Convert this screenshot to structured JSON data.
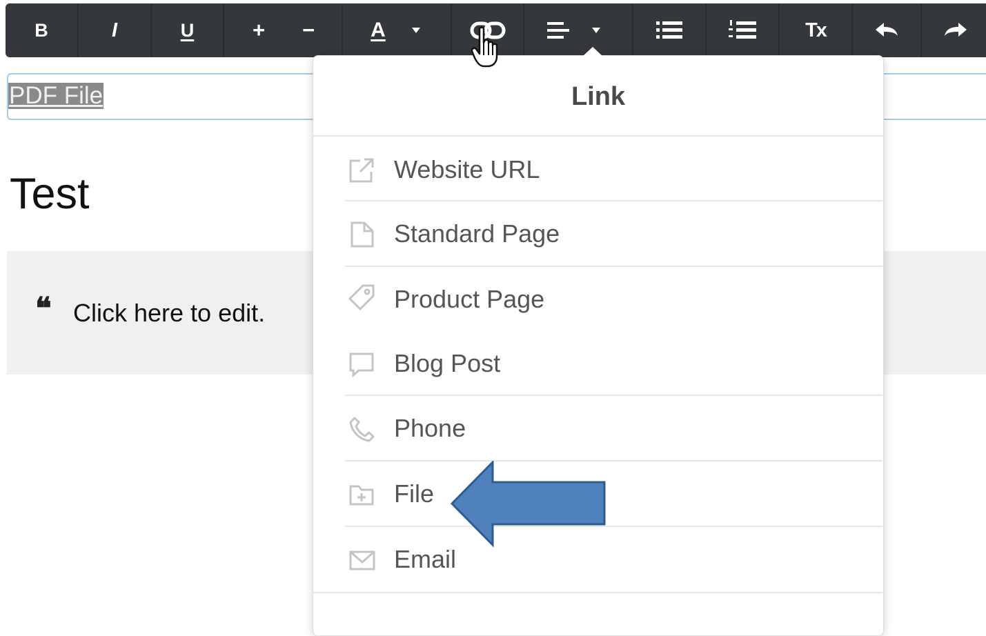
{
  "toolbar": {
    "bold": "B",
    "italic": "I",
    "underline": "U",
    "increase_size": "+",
    "decrease_size": "−",
    "text_color": "A",
    "clear_format": "Tx"
  },
  "field": {
    "value": "PDF File"
  },
  "content": {
    "heading": "Test",
    "quote_mark": "❝",
    "quote_text": "Click here to edit."
  },
  "link_menu": {
    "title": "Link",
    "items": [
      {
        "label": "Website URL",
        "icon": "external-link-icon"
      },
      {
        "label": "Standard Page",
        "icon": "page-icon"
      },
      {
        "label": "Product Page",
        "icon": "tag-icon"
      },
      {
        "label": "Blog Post",
        "icon": "speech-bubble-icon"
      },
      {
        "label": "Phone",
        "icon": "phone-icon"
      },
      {
        "label": "File",
        "icon": "folder-upload-icon"
      },
      {
        "label": "Email",
        "icon": "envelope-icon"
      }
    ]
  },
  "colors": {
    "toolbar_bg": "#34373c",
    "field_border": "#9ed0ef",
    "arrow_fill": "#4f81bd",
    "arrow_stroke": "#2f5b8e"
  }
}
